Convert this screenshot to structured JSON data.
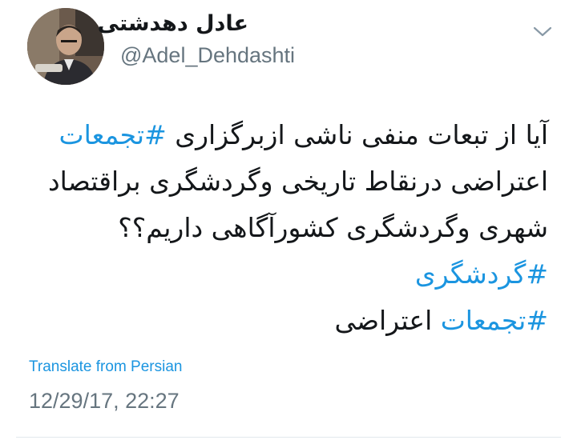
{
  "tweet": {
    "author": {
      "display_name": "عادل دهدشتی",
      "handle": "@Adel_Dehdashti"
    },
    "body": {
      "line1_text": "آیا از تبعات منفی ناشی ازبرگزاری ",
      "line1_hashtag": "#تجمعات",
      "line2": "اعتراضی درنقاط تاریخی وگردشگری براقتصاد",
      "line3": "شهری وگردشگری کشورآگاهی داریم؟؟",
      "line4_hashtag": "#گردشگری",
      "line5_hashtag": "#تجمعات",
      "line5_text": " اعتراضی"
    },
    "translate_label": "Translate from Persian",
    "timestamp": "12/29/17, 22:27",
    "menu_icon": "chevron-down-icon",
    "colors": {
      "link": "#1b95e0",
      "secondary": "#66757f",
      "text": "#14171a"
    }
  }
}
